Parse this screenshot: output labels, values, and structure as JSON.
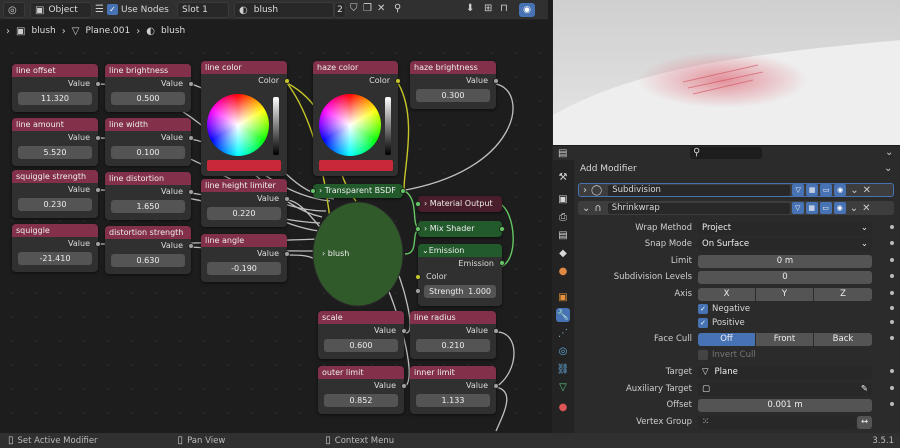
{
  "header": {
    "mode": "Object",
    "use_nodes_label": "Use Nodes",
    "slot": "Slot 1",
    "material_name": "blush",
    "user_count": "2"
  },
  "breadcrumb": [
    "blush",
    "Plane.001",
    "blush"
  ],
  "nodes": {
    "line_offset": {
      "title": "line offset",
      "out": "Value",
      "value": "11.320"
    },
    "line_amount": {
      "title": "line amount",
      "out": "Value",
      "value": "5.520"
    },
    "squiggle_strength": {
      "title": "squiggle strength",
      "out": "Value",
      "value": "0.230"
    },
    "squiggle": {
      "title": "squiggle",
      "out": "Value",
      "value": "-21.410"
    },
    "line_brightness": {
      "title": "line brightness",
      "out": "Value",
      "value": "0.500"
    },
    "line_width": {
      "title": "line width",
      "out": "Value",
      "value": "0.100"
    },
    "line_distortion": {
      "title": "line distortion",
      "out": "Value",
      "value": "1.650"
    },
    "distortion_strength": {
      "title": "distortion strength",
      "out": "Value",
      "value": "0.630"
    },
    "line_color": {
      "title": "line color",
      "out": "Color",
      "swatch": "#c8283a"
    },
    "line_height_limiter": {
      "title": "line height limiter",
      "out": "Value",
      "value": "0.220"
    },
    "line_angle": {
      "title": "line angle",
      "out": "Value",
      "value": "-0.190"
    },
    "haze_color": {
      "title": "haze color",
      "out": "Color",
      "swatch": "#c8283a"
    },
    "haze_brightness": {
      "title": "haze brightness",
      "out": "Value",
      "value": "0.300"
    },
    "transparent_bsdf": {
      "title": "Transparent BSDF"
    },
    "material_output": {
      "title": "Material Output"
    },
    "mix_shader": {
      "title": "Mix Shader"
    },
    "emission": {
      "title": "Emission",
      "out": "Emission",
      "color_label": "Color",
      "strength_label": "Strength",
      "strength": "1.000"
    },
    "blush_group": {
      "title": "blush"
    },
    "scale": {
      "title": "scale",
      "out": "Value",
      "value": "0.600"
    },
    "line_radius": {
      "title": "line radius",
      "out": "Value",
      "value": "0.210"
    },
    "outer_limit": {
      "title": "outer limit",
      "out": "Value",
      "value": "0.852"
    },
    "inner_limit": {
      "title": "inner limit",
      "out": "Value",
      "value": "1.133"
    }
  },
  "properties": {
    "add_modifier": "Add Modifier",
    "modifiers": [
      "Subdivision",
      "Shrinkwrap"
    ],
    "fields": {
      "wrap_method": {
        "label": "Wrap Method",
        "value": "Project"
      },
      "snap_mode": {
        "label": "Snap Mode",
        "value": "On Surface"
      },
      "limit": {
        "label": "Limit",
        "value": "0 m"
      },
      "subdivision_levels": {
        "label": "Subdivision Levels",
        "value": "0"
      },
      "axis": {
        "label": "Axis",
        "x": "X",
        "y": "Y",
        "z": "Z"
      },
      "negative": "Negative",
      "positive": "Positive",
      "face_cull": {
        "label": "Face Cull",
        "off": "Off",
        "front": "Front",
        "back": "Back"
      },
      "invert_cull": "Invert Cull",
      "target": {
        "label": "Target",
        "value": "Plane"
      },
      "aux_target": {
        "label": "Auxiliary Target",
        "value": ""
      },
      "offset": {
        "label": "Offset",
        "value": "0.001 m"
      },
      "vertex_group": {
        "label": "Vertex Group",
        "value": ""
      }
    }
  },
  "status": {
    "left": "Set Active Modifier",
    "mid": "Pan View",
    "right": "Context Menu",
    "version": "3.5.1"
  },
  "colors": {
    "accent": "#4772b3",
    "node_header_red": "#83314a",
    "shader_green": "#235a2c"
  }
}
